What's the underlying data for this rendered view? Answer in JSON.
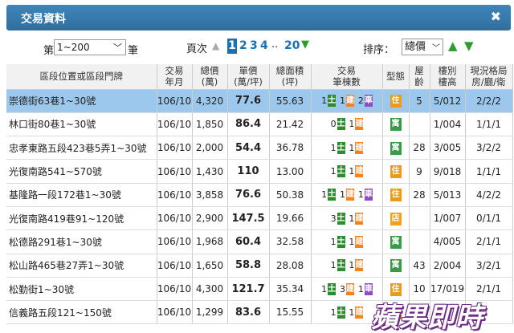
{
  "header": {
    "title": "交易資料",
    "close": "✖"
  },
  "controls": {
    "page_size_prefix": "第",
    "page_size_value": "1~200",
    "page_size_unit": "筆",
    "pager_label": "頁次",
    "pager_prev": "▲",
    "pager_current": "1",
    "pager_pages": [
      "2",
      "3",
      "4"
    ],
    "pager_ellipsis": "..",
    "pager_last": "20",
    "pager_next": "▼",
    "sort_label": "排序：",
    "sort_value": "總價",
    "sort_up": "▲",
    "sort_down": "▼"
  },
  "table": {
    "headers": {
      "address": "區段位置或區段門牌",
      "date": [
        "交易",
        "年月"
      ],
      "total": [
        "總價",
        "(萬)"
      ],
      "unit": [
        "單價",
        "(萬/坪)"
      ],
      "area": [
        "總面積",
        "(坪)"
      ],
      "count": [
        "交易",
        "筆棟數"
      ],
      "type": "型態",
      "age": [
        "屋",
        "齡"
      ],
      "floor": [
        "樓別",
        "樓高"
      ],
      "layout": [
        "現況格局",
        "房/廳/衛"
      ]
    },
    "tag_labels": {
      "land": "土",
      "building": "建",
      "car": "車"
    },
    "rows": [
      {
        "address": "崇德街63巷1~30號",
        "date": "106/10",
        "total": "4,320",
        "unit": "77.6",
        "area": "55.63",
        "land": "1",
        "building": "1",
        "car": "2",
        "type": "住",
        "age": "5",
        "floor": "5/012",
        "layout": "2/2/2"
      },
      {
        "address": "林口街80巷1~30號",
        "date": "106/10",
        "total": "1,850",
        "unit": "86.4",
        "area": "21.42",
        "land": "0",
        "building": "1",
        "car": "",
        "type": "寓",
        "age": "",
        "floor": "1/004",
        "layout": "1/1/1"
      },
      {
        "address": "忠孝東路五段423巷5弄1~30號",
        "date": "106/10",
        "total": "2,000",
        "unit": "54.4",
        "area": "36.78",
        "land": "1",
        "building": "1",
        "car": "",
        "type": "寓",
        "age": "28",
        "floor": "3/005",
        "layout": "3/2/2"
      },
      {
        "address": "光復南路541~570號",
        "date": "106/10",
        "total": "1,430",
        "unit": "110",
        "area": "13.00",
        "land": "1",
        "building": "1",
        "car": "",
        "type": "住",
        "age": "9",
        "floor": "9/018",
        "layout": "1/1/1"
      },
      {
        "address": "基隆路一段172巷1~30號",
        "date": "106/10",
        "total": "3,858",
        "unit": "76.6",
        "area": "50.38",
        "land": "1",
        "building": "1",
        "car": "1",
        "type": "住",
        "age": "28",
        "floor": "5/013",
        "layout": "4/2/2"
      },
      {
        "address": "光復南路419巷91~120號",
        "date": "106/10",
        "total": "2,900",
        "unit": "147.5",
        "area": "19.66",
        "land": "3",
        "building": "1",
        "car": "",
        "type": "店",
        "age": "",
        "floor": "1/007",
        "layout": "0/1/1"
      },
      {
        "address": "松德路291巷1~30號",
        "date": "106/10",
        "total": "1,968",
        "unit": "60.4",
        "area": "32.58",
        "land": "1",
        "building": "1",
        "car": "",
        "type": "寓",
        "age": "",
        "floor": "4/005",
        "layout": "2/1/1"
      },
      {
        "address": "松山路465巷27弄1~30號",
        "date": "106/10",
        "total": "1,650",
        "unit": "58.8",
        "area": "28.08",
        "land": "1",
        "building": "1",
        "car": "",
        "type": "寓",
        "age": "43",
        "floor": "2/004",
        "layout": "3/2/1"
      },
      {
        "address": "松勤街1~30號",
        "date": "106/10",
        "total": "4,300",
        "unit": "121.7",
        "area": "35.34",
        "land": "1",
        "building": "3",
        "car": "1",
        "type": "住",
        "age": "10",
        "floor": "17/019",
        "layout": "2/1/1"
      },
      {
        "address": "信義路五段121~150號",
        "date": "106/10",
        "total": "1,299",
        "unit": "83.6",
        "area": "15.55",
        "land": "1",
        "building": "1",
        "car": "",
        "type": "住",
        "age": "",
        "floor": "",
        "layout": ""
      }
    ]
  },
  "watermark": "蘋果即時",
  "colors": {
    "header_bg": "#2f6f9f",
    "selected_row": "#9cc8ee",
    "land_tag": "#2e8b2e",
    "building_tag": "#f58220",
    "car_tag": "#8b4fc0"
  }
}
